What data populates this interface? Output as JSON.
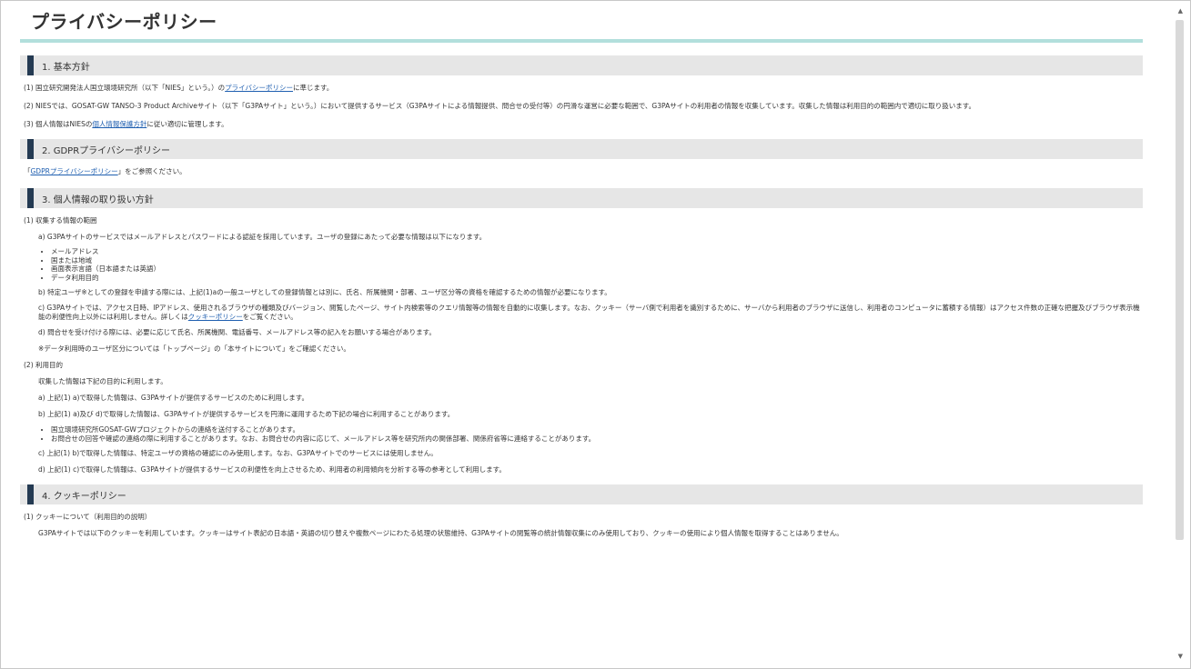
{
  "page_title": "プライバシーポリシー",
  "s1": {
    "heading": "1. 基本方針",
    "p1_pre": "(1) 国立研究開発法人国立環境研究所（以下「NIES」という。）の",
    "p1_link": "プライバシーポリシー",
    "p1_post": "に準じます。",
    "p2": "(2) NIESでは、GOSAT-GW TANSO-3 Product Archiveサイト（以下「G3PAサイト」という。）において提供するサービス（G3PAサイトによる情報提供、問合せの受付等）の円滑な運営に必要な範囲で、G3PAサイトの利用者の情報を収集しています。収集した情報は利用目的の範囲内で適切に取り扱います。",
    "p3_pre": "(3) 個人情報はNIESの",
    "p3_link": "個人情報保護方針",
    "p3_post": "に従い適切に管理します。"
  },
  "s2": {
    "heading": "2. GDPRプライバシーポリシー",
    "p1_open": "「",
    "p1_link": "GDPRプライバシーポリシー",
    "p1_post": "」をご参照ください。"
  },
  "s3": {
    "heading": "3. 個人情報の取り扱い方針",
    "sub1": "(1) 収集する情報の範囲",
    "a": "a) G3PAサイトのサービスではメールアドレスとパスワードによる認証を採用しています。ユーザの登録にあたって必要な情報は以下になります。",
    "bullets": [
      "メールアドレス",
      "国または地域",
      "画面表示言語（日本語または英語）",
      "データ利用目的"
    ],
    "b": "b) 特定ユーザ※としての登録を申請する際には、上記(1)aの一般ユーザとしての登録情報とは別に、氏名、所属機関・部署、ユーザ区分等の資格を確認するための情報が必要になります。",
    "c_pre": "c) G3PAサイトでは、アクセス日時、IPアドレス、使用されるブラウザの種類及びバージョン、閲覧したページ、サイト内検索等のクエリ情報等の情報を自動的に収集します。なお、クッキー（サーバ側で利用者を識別するために、サーバから利用者のブラウザに送信し、利用者のコンピュータに蓄積する情報）はアクセス件数の正確な把握及びブラウザ表示機能の利便性向上以外には利用しません。詳しくは",
    "c_link": "クッキーポリシー",
    "c_post": "をご覧ください。",
    "d": "d) 問合せを受け付ける際には、必要に応じて氏名、所属機関、電話番号、メールアドレス等の記入をお願いする場合があります。",
    "note": "※データ利用時のユーザ区分については「トップページ」の「本サイトについて」をご確認ください。",
    "sub2": "(2) 利用目的",
    "intro": "収集した情報は下記の目的に利用します。",
    "pa": "a) 上記(1) a)で取得した情報は、G3PAサイトが提供するサービスのために利用します。",
    "pb": "b) 上記(1) a)及び d)で取得した情報は、G3PAサイトが提供するサービスを円滑に運用するため下記の場合に利用することがあります。",
    "pb_bullets": [
      "国立環境研究所GOSAT-GWプロジェクトからの連絡を送付することがあります。",
      "お問合せの回答や確認の連絡の際に利用することがあります。なお、お問合せの内容に応じて、メールアドレス等を研究所内の関係部署、関係府省等に連絡することがあります。"
    ],
    "pc": "c) 上記(1) b)で取得した情報は、特定ユーザの資格の確認にのみ使用します。なお、G3PAサイトでのサービスには使用しません。",
    "pd": "d) 上記(1) c)で取得した情報は、G3PAサイトが提供するサービスの利便性を向上させるため、利用者の利用傾向を分析する等の参考として利用します。"
  },
  "s4": {
    "heading": "4. クッキーポリシー",
    "sub1": "(1) クッキーについて（利用目的の説明）",
    "p1": "G3PAサイトでは以下のクッキーを利用しています。クッキーはサイト表記の日本語・英語の切り替えや複数ページにわたる処理の状態維持、G3PAサイトの閲覧等の統計情報収集にのみ使用しており、クッキーの使用により個人情報を取得することはありません。"
  }
}
